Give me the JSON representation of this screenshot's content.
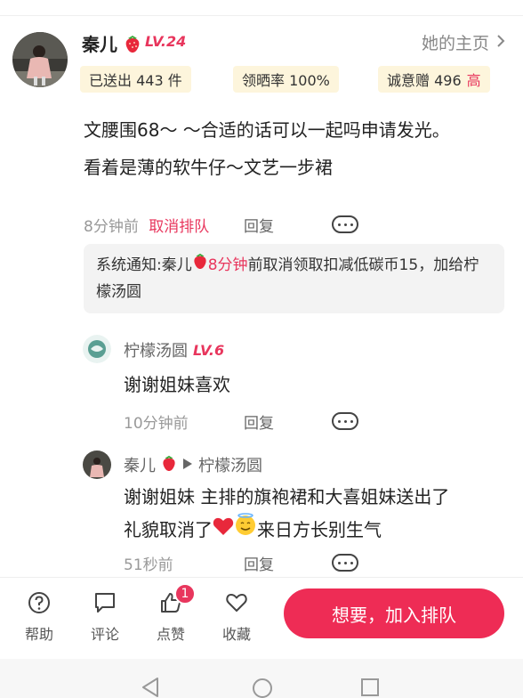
{
  "author": {
    "name": "秦儿",
    "level": "LV.24",
    "homepage_link": "她的主页",
    "stats": {
      "sent": "已送出 443 件",
      "review_rate": "领晒率 100%",
      "sincerity": "诚意赠 496",
      "sincerity_tag": "高"
    }
  },
  "comment": {
    "line1": "文腰围68～ ～合适的话可以一起吗申请发光。",
    "line2": "看着是薄的软牛仔～文艺一步裙",
    "time": "8分钟前",
    "cancel_label": "取消排队",
    "reply_label": "回复"
  },
  "system_notice": {
    "prefix": "系统通知:秦儿",
    "highlight": "8分钟",
    "suffix": "前取消领取扣减低碳币15，加给柠檬汤圆"
  },
  "replies": [
    {
      "name": "柠檬汤圆",
      "level": "LV.6",
      "text": "谢谢姐妹喜欢",
      "time": "10分钟前",
      "reply_label": "回复"
    },
    {
      "name": "秦儿",
      "to_name": "柠檬汤圆",
      "text_line1": "谢谢姐妹 主排的旗袍裙和大喜姐妹送出了",
      "text_line2_a": "礼貌取消了",
      "text_line2_b": "来日方长别生气",
      "time": "51秒前",
      "reply_label": "回复"
    }
  ],
  "bottom_bar": {
    "help": "帮助",
    "comment": "评论",
    "like": "点赞",
    "like_count": "1",
    "favorite": "收藏",
    "cta": "想要，加入排队"
  },
  "colors": {
    "accent": "#ee2c55",
    "level": "#e8365d",
    "badge_bg": "#fdf5dc"
  },
  "icons": [
    "strawberry-icon",
    "chevron-right-icon",
    "more-icon",
    "help-icon",
    "comment-icon",
    "like-icon",
    "favorite-icon",
    "back-nav-icon",
    "home-nav-icon",
    "recent-nav-icon",
    "reply-arrow-icon",
    "heart-emoji",
    "smile-emoji"
  ]
}
